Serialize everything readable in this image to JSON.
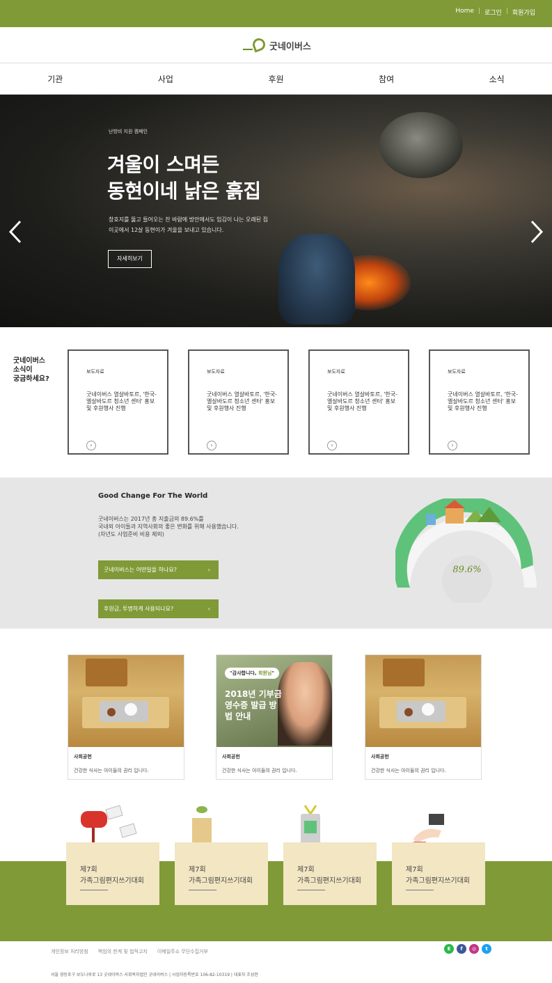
{
  "topbar": {
    "links": [
      "Home",
      "로그인",
      "회원가입"
    ]
  },
  "brand": {
    "name": "굿네이버스"
  },
  "nav": {
    "items": [
      "기관",
      "사업",
      "후원",
      "참여",
      "소식"
    ]
  },
  "hero": {
    "campaign": "난방비 지원 캠페인",
    "title_line1": "겨울이 스며든",
    "title_line2": "동현이네 낡은 흙집",
    "desc_line1": "창호지를 뚫고 들어오는 찬 바람에 방안에서도 입김이 나는 오래된 집",
    "desc_line2": "이곳에서 12살 동현이가 겨울을 보내고 있습니다.",
    "more": "자세히보기"
  },
  "news": {
    "label": [
      "굿네이버스",
      "소식이",
      "궁금하세요?"
    ],
    "cards": [
      {
        "tag": "보도자료",
        "title": "굿네이버스 열살바토르, '한국-엘살바도르 청소년 센터' 홍보 및 후원행사 진행"
      },
      {
        "tag": "보도자료",
        "title": "굿네이버스 열살바토르, '한국-엘살바도르 청소년 센터' 홍보 및 후원행사 진행"
      },
      {
        "tag": "보도자료",
        "title": "굿네이버스 열살바토르, '한국-엘살바도르 청소년 센터' 홍보 및 후원행사 진행"
      },
      {
        "tag": "보도자료",
        "title": "굿네이버스 열살바토르, '한국-엘살바도르 청소년 센터' 홍보 및 후원행사 진행"
      }
    ]
  },
  "impact": {
    "heading": "Good Change For The World",
    "text_line1": "굿네이버스는 2017년 총 지출금의 89.6%를",
    "text_line2": "국내외 아이들과 지역사회의 좋은 변화를 위해 사용했습니다.",
    "text_line3": "(차년도 사업준비 비용 제외)",
    "button1": "굿네이버스는 어떤일을 하나요?",
    "button2": "후원금, 투명하게 사용되나요?",
    "percent_label": "89.6%",
    "percent_value": 89.6
  },
  "photos": {
    "cards": [
      {
        "category": "사회공헌",
        "caption": "건강한 식사는 아이들의 권리 입니다."
      },
      {
        "category": "사회공헌",
        "caption": "건강한 식사는 아이들의 권리 입니다."
      },
      {
        "category": "사회공헌",
        "caption": "건강한 식사는 아이들의 권리 입니다."
      }
    ],
    "poster": {
      "tagline_prefix": "\"감사합니다, ",
      "tagline_highlight": "회원님",
      "tagline_suffix": "\"",
      "title": "2018년 기부금영수증 발급 방법 안내"
    }
  },
  "contests": [
    {
      "round": "제7회",
      "name": "가족그림편지쓰기대회",
      "icon": "mailbox-icon"
    },
    {
      "round": "제7회",
      "name": "가족그림편지쓰기대회",
      "icon": "building-icon"
    },
    {
      "round": "제7회",
      "name": "가족그림편지쓰기대회",
      "icon": "id-card-icon"
    },
    {
      "round": "제7회",
      "name": "가족그림편지쓰기대회",
      "icon": "gift-hand-icon"
    }
  ],
  "footer": {
    "links": [
      "개인정보 처리방침",
      "책임의 한계 및 법적고지",
      "이메일주소 무단수집거부"
    ],
    "address": "서울 영등포구 보도나루로 13 굿네이버스 사회복지법인 굿네이버스 | 사업자등록번호 106-82-10319 | 대표자 조성현",
    "social": [
      "E",
      "f",
      "◎",
      "t"
    ]
  },
  "colors": {
    "brand_green": "#7f9a37",
    "chart_green": "#5fc27a",
    "contest_bg": "#f2e6c3"
  }
}
